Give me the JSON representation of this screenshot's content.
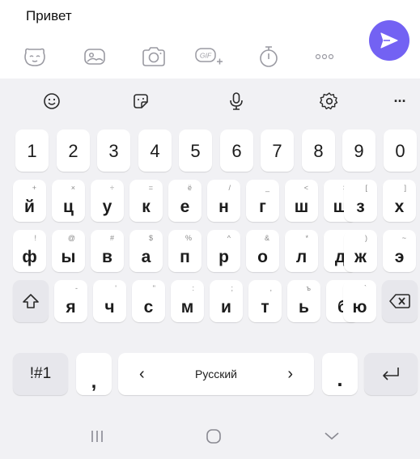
{
  "compose": {
    "message_text": "Привет",
    "attach_icons": [
      "sticker-icon",
      "gallery-icon",
      "camera-icon",
      "gif-icon",
      "timer-icon",
      "more-icon"
    ],
    "gif_label": "GIF"
  },
  "keyboard": {
    "toolbar": [
      "emoji-icon",
      "sticker-icon",
      "microphone-icon",
      "settings-icon",
      "more-icon"
    ],
    "more_label": "···",
    "number_row": [
      "1",
      "2",
      "3",
      "4",
      "5",
      "6",
      "7",
      "8",
      "9",
      "0"
    ],
    "row1": [
      {
        "main": "й",
        "sub": "+"
      },
      {
        "main": "ц",
        "sub": "×"
      },
      {
        "main": "у",
        "sub": "÷"
      },
      {
        "main": "к",
        "sub": "="
      },
      {
        "main": "е",
        "sub": "ё"
      },
      {
        "main": "н",
        "sub": "/"
      },
      {
        "main": "г",
        "sub": "_"
      },
      {
        "main": "ш",
        "sub": "<"
      },
      {
        "main": "щ",
        "sub": ">"
      },
      {
        "main": "з",
        "sub": "["
      },
      {
        "main": "х",
        "sub": "]"
      }
    ],
    "row2": [
      {
        "main": "ф",
        "sub": "!"
      },
      {
        "main": "ы",
        "sub": "@"
      },
      {
        "main": "в",
        "sub": "#"
      },
      {
        "main": "а",
        "sub": "$"
      },
      {
        "main": "п",
        "sub": "%"
      },
      {
        "main": "р",
        "sub": "^"
      },
      {
        "main": "о",
        "sub": "&"
      },
      {
        "main": "л",
        "sub": "*"
      },
      {
        "main": "д",
        "sub": "("
      },
      {
        "main": "ж",
        "sub": ")"
      },
      {
        "main": "э",
        "sub": "~"
      }
    ],
    "row3": [
      {
        "main": "я",
        "sub": "-"
      },
      {
        "main": "ч",
        "sub": "'"
      },
      {
        "main": "с",
        "sub": "\""
      },
      {
        "main": "м",
        "sub": ":"
      },
      {
        "main": "и",
        "sub": ";"
      },
      {
        "main": "т",
        "sub": ","
      },
      {
        "main": "ь",
        "sub": "ъ"
      },
      {
        "main": "б",
        "sub": "?"
      },
      {
        "main": "ю",
        "sub": "`"
      }
    ],
    "symbols_label": "!#1",
    "comma_label": ",",
    "space_label": "Русский",
    "lang_prev": "‹",
    "lang_next": "›",
    "period_label": "."
  },
  "navbar": [
    "recent-apps-icon",
    "home-icon",
    "back-icon"
  ]
}
